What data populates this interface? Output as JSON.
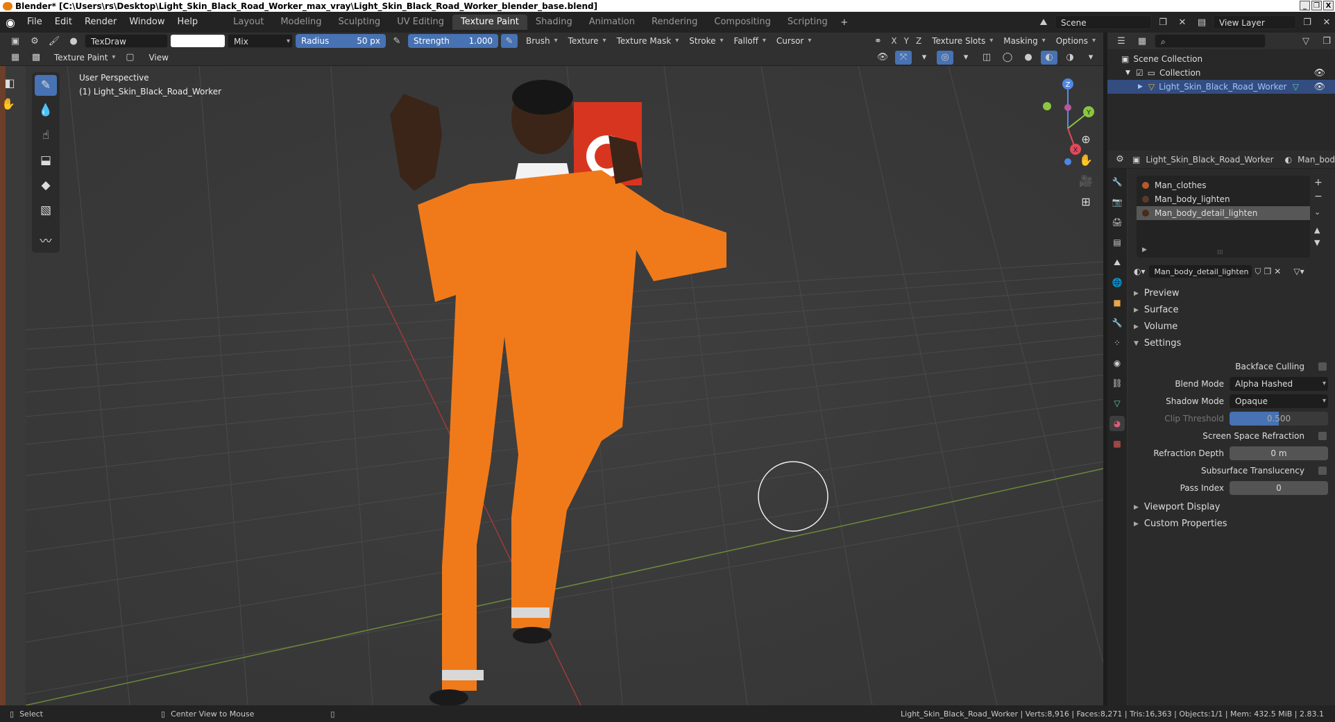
{
  "window": {
    "title": "Blender* [C:\\Users\\rs\\Desktop\\Light_Skin_Black_Road_Worker_max_vray\\Light_Skin_Black_Road_Worker_blender_base.blend]",
    "min": "_",
    "max": "❐",
    "close": "X"
  },
  "menu": [
    "File",
    "Edit",
    "Render",
    "Window",
    "Help"
  ],
  "workspaces": [
    "Layout",
    "Modeling",
    "Sculpting",
    "UV Editing",
    "Texture Paint",
    "Shading",
    "Animation",
    "Rendering",
    "Compositing",
    "Scripting"
  ],
  "scene": {
    "name": "Scene",
    "view_layer": "View Layer"
  },
  "tool_header": {
    "brush": "TexDraw",
    "blend": "Mix",
    "radius_label": "Radius",
    "radius_value": "50 px",
    "strength_label": "Strength",
    "strength_value": "1.000",
    "brush_dd": "Brush",
    "texture_dd": "Texture",
    "texture_mask_dd": "Texture Mask",
    "stroke_dd": "Stroke",
    "falloff_dd": "Falloff",
    "cursor_dd": "Cursor",
    "axes": [
      "X",
      "Y",
      "Z"
    ],
    "texture_slots": "Texture Slots",
    "masking": "Masking",
    "options": "Options"
  },
  "header2": {
    "mode": "Texture Paint",
    "view": "View"
  },
  "viewport": {
    "perspective": "User Perspective",
    "object": "(1) Light_Skin_Black_Road_Worker",
    "axis_labels": {
      "z": "Z",
      "y": "Y",
      "x": "X"
    }
  },
  "outliner": {
    "root": "Scene Collection",
    "collection": "Collection",
    "object": "Light_Skin_Black_Road_Worker"
  },
  "properties": {
    "object_name": "Light_Skin_Black_Road_Worker",
    "material_short": "Man_bod",
    "slots": [
      "Man_clothes",
      "Man_body_lighten",
      "Man_body_detail_lighten"
    ],
    "material": "Man_body_detail_lighten",
    "panels": {
      "preview": "Preview",
      "surface": "Surface",
      "volume": "Volume",
      "settings": "Settings",
      "viewport_display": "Viewport Display",
      "custom_props": "Custom Properties"
    },
    "settings": {
      "backface_culling": "Backface Culling",
      "blend_mode_label": "Blend Mode",
      "blend_mode": "Alpha Hashed",
      "shadow_mode_label": "Shadow Mode",
      "shadow_mode": "Opaque",
      "clip_threshold_label": "Clip Threshold",
      "clip_threshold": "0.500",
      "ssr": "Screen Space Refraction",
      "refraction_depth_label": "Refraction Depth",
      "refraction_depth": "0 m",
      "subsurface": "Subsurface Translucency",
      "pass_index_label": "Pass Index",
      "pass_index": "0"
    }
  },
  "status": {
    "select": "Select",
    "center": "Center View to Mouse",
    "stats": "Light_Skin_Black_Road_Worker | Verts:8,916 | Faces:8,271 | Tris:16,363 | Objects:1/1 | Mem: 432.5 MiB | 2.83.1"
  },
  "colors": {
    "accent": "#4772b3",
    "selection": "#334d80",
    "orange_suit": "#f07a1a"
  }
}
